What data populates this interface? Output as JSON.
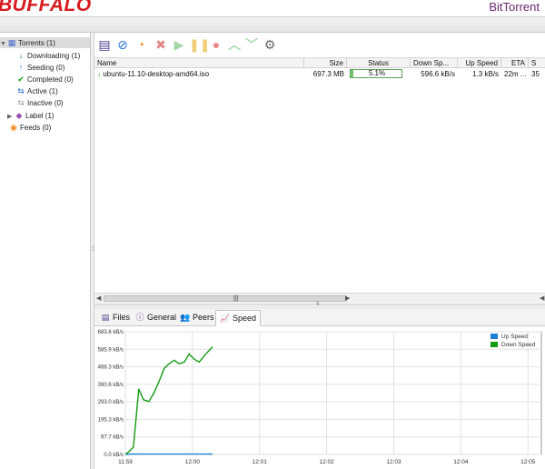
{
  "header": {
    "brand_left": "BUFFALO",
    "brand_right": "BitTorrent"
  },
  "sidebar": {
    "items": [
      {
        "label": "Torrents (1)",
        "icon": "torrents-icon",
        "selected": true
      },
      {
        "label": "Downloading (1)",
        "icon": "download-arrow-icon"
      },
      {
        "label": "Seeding (0)",
        "icon": "upload-arrow-icon"
      },
      {
        "label": "Completed (0)",
        "icon": "checkmark-icon"
      },
      {
        "label": "Active (1)",
        "icon": "active-arrows-icon"
      },
      {
        "label": "Inactive (0)",
        "icon": "inactive-arrows-icon"
      },
      {
        "label": "Label (1)",
        "icon": "label-tag-icon"
      },
      {
        "label": "Feeds (0)",
        "icon": "rss-feed-icon"
      }
    ]
  },
  "toolbar": {
    "buttons": [
      {
        "name": "add-torrent-button",
        "icon": "add-file-icon"
      },
      {
        "name": "add-url-button",
        "icon": "add-link-icon"
      },
      {
        "name": "add-rss-button",
        "icon": "add-rss-icon"
      },
      {
        "name": "remove-button",
        "icon": "close-x-icon"
      },
      {
        "name": "start-button",
        "icon": "play-icon"
      },
      {
        "name": "pause-button",
        "icon": "pause-icon"
      },
      {
        "name": "stop-button",
        "icon": "stop-icon"
      },
      {
        "name": "move-up-button",
        "icon": "chevron-up-icon"
      },
      {
        "name": "move-down-button",
        "icon": "chevron-down-icon"
      },
      {
        "name": "settings-button",
        "icon": "gear-icon"
      }
    ]
  },
  "table": {
    "columns": [
      "Name",
      "Size",
      "Status",
      "Down Sp...",
      "Up Speed",
      "ETA",
      "S"
    ],
    "rows": [
      {
        "name": "ubuntu-11.10-desktop-amd64.iso",
        "size": "697.3 MB",
        "status": "5.1%",
        "progress": 0.051,
        "down_speed": "596.6 kB/s",
        "up_speed": "1.3 kB/s",
        "eta": "22m ...",
        "seeds": "35"
      }
    ]
  },
  "tabs": [
    {
      "label": "Files",
      "icon": "files-icon"
    },
    {
      "label": "General",
      "icon": "info-icon"
    },
    {
      "label": "Peers",
      "icon": "peers-icon"
    },
    {
      "label": "Speed",
      "icon": "speed-graph-icon",
      "active": true
    }
  ],
  "chart_data": {
    "type": "line",
    "xlabel": "",
    "ylabel": "",
    "yunit": "kB/s",
    "ylim": [
      0,
      683.6
    ],
    "y_ticks": [
      "0.0 kB/s",
      "97.7 kB/s",
      "195.3 kB/s",
      "293.0 kB/s",
      "390.6 kB/s",
      "488.3 kB/s",
      "585.9 kB/s",
      "683.6 kB/s"
    ],
    "y_tick_values": [
      0,
      97.7,
      195.3,
      293.0,
      390.6,
      488.3,
      585.9,
      683.6
    ],
    "x_ticks": [
      "11:59",
      "12:00",
      "12:01",
      "12:02",
      "12:03",
      "12:04",
      "12:05"
    ],
    "x_tick_minutes": [
      0,
      1,
      2,
      3,
      4,
      5,
      6
    ],
    "xlim_minutes": [
      0,
      6.2
    ],
    "grid": true,
    "legend_position": "top-right",
    "series": [
      {
        "name": "Up Speed",
        "color": "#1e7fd6",
        "x_minutes": [
          -0.1,
          0.1,
          0.2,
          0.3,
          0.5,
          0.7,
          0.9,
          1.1,
          1.3
        ],
        "values": [
          0,
          3,
          2,
          2,
          2,
          2,
          2,
          2,
          2
        ]
      },
      {
        "name": "Down Speed",
        "color": "#139a13",
        "x_minutes": [
          -0.1,
          0.05,
          0.12,
          0.2,
          0.27,
          0.35,
          0.43,
          0.5,
          0.58,
          0.65,
          0.73,
          0.8,
          0.88,
          0.95,
          1.03,
          1.1,
          1.2,
          1.3
        ],
        "values": [
          0,
          15,
          40,
          365,
          305,
          295,
          345,
          405,
          480,
          505,
          525,
          505,
          515,
          560,
          530,
          515,
          560,
          600
        ]
      }
    ]
  }
}
